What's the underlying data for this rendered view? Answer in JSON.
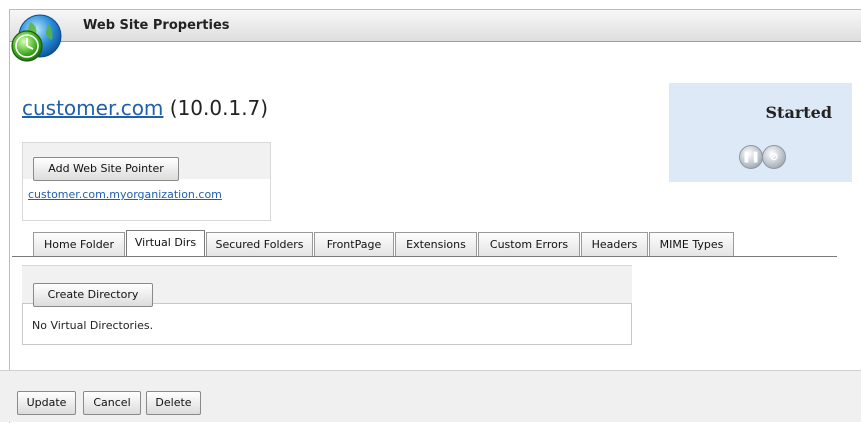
{
  "window": {
    "title": "Web Site Properties",
    "icon": "globe-clock-icon"
  },
  "site": {
    "domain": "customer.com",
    "ip": "(10.0.1.7)"
  },
  "pointers": {
    "add_button": "Add Web Site Pointer",
    "items": [
      "customer.com.myorganization.com"
    ]
  },
  "status": {
    "text": "Started",
    "pause_icon": "pause-icon",
    "stop_icon": "stop-icon"
  },
  "tabs": [
    {
      "label": "Home Folder"
    },
    {
      "label": "Virtual Dirs",
      "active": true
    },
    {
      "label": "Secured Folders"
    },
    {
      "label": "FrontPage"
    },
    {
      "label": "Extensions"
    },
    {
      "label": "Custom Errors"
    },
    {
      "label": "Headers"
    },
    {
      "label": "MIME Types"
    }
  ],
  "virtual_dirs": {
    "create_button": "Create Directory",
    "empty_text": "No Virtual Directories."
  },
  "footer": {
    "update": "Update",
    "cancel": "Cancel",
    "delete": "Delete"
  }
}
